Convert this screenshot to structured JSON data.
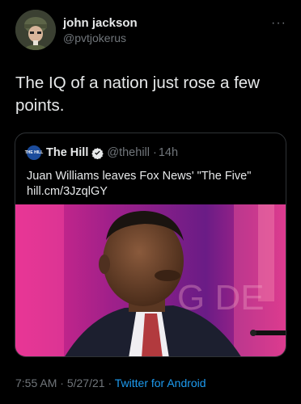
{
  "author": {
    "display_name": "john jackson",
    "handle": "@pvtjokerus"
  },
  "more_icon": "more-dots-icon",
  "tweet": {
    "text": "The IQ of a nation just rose a few points."
  },
  "quote": {
    "logo_text": "THE HILL",
    "name": "The Hill",
    "handle": "@thehill",
    "separator": "·",
    "time": "14h",
    "text": "Juan Williams leaves Fox News' \"The Five\"",
    "link": "hill.cm/3JzqlGY"
  },
  "meta": {
    "time": "7:55 AM",
    "sep1": "·",
    "date": "5/27/21",
    "sep2": "·",
    "app": "Twitter for Android"
  },
  "colors": {
    "link_blue": "#1d9bf0",
    "muted": "#71767b",
    "verified": "#1d9bf0"
  }
}
